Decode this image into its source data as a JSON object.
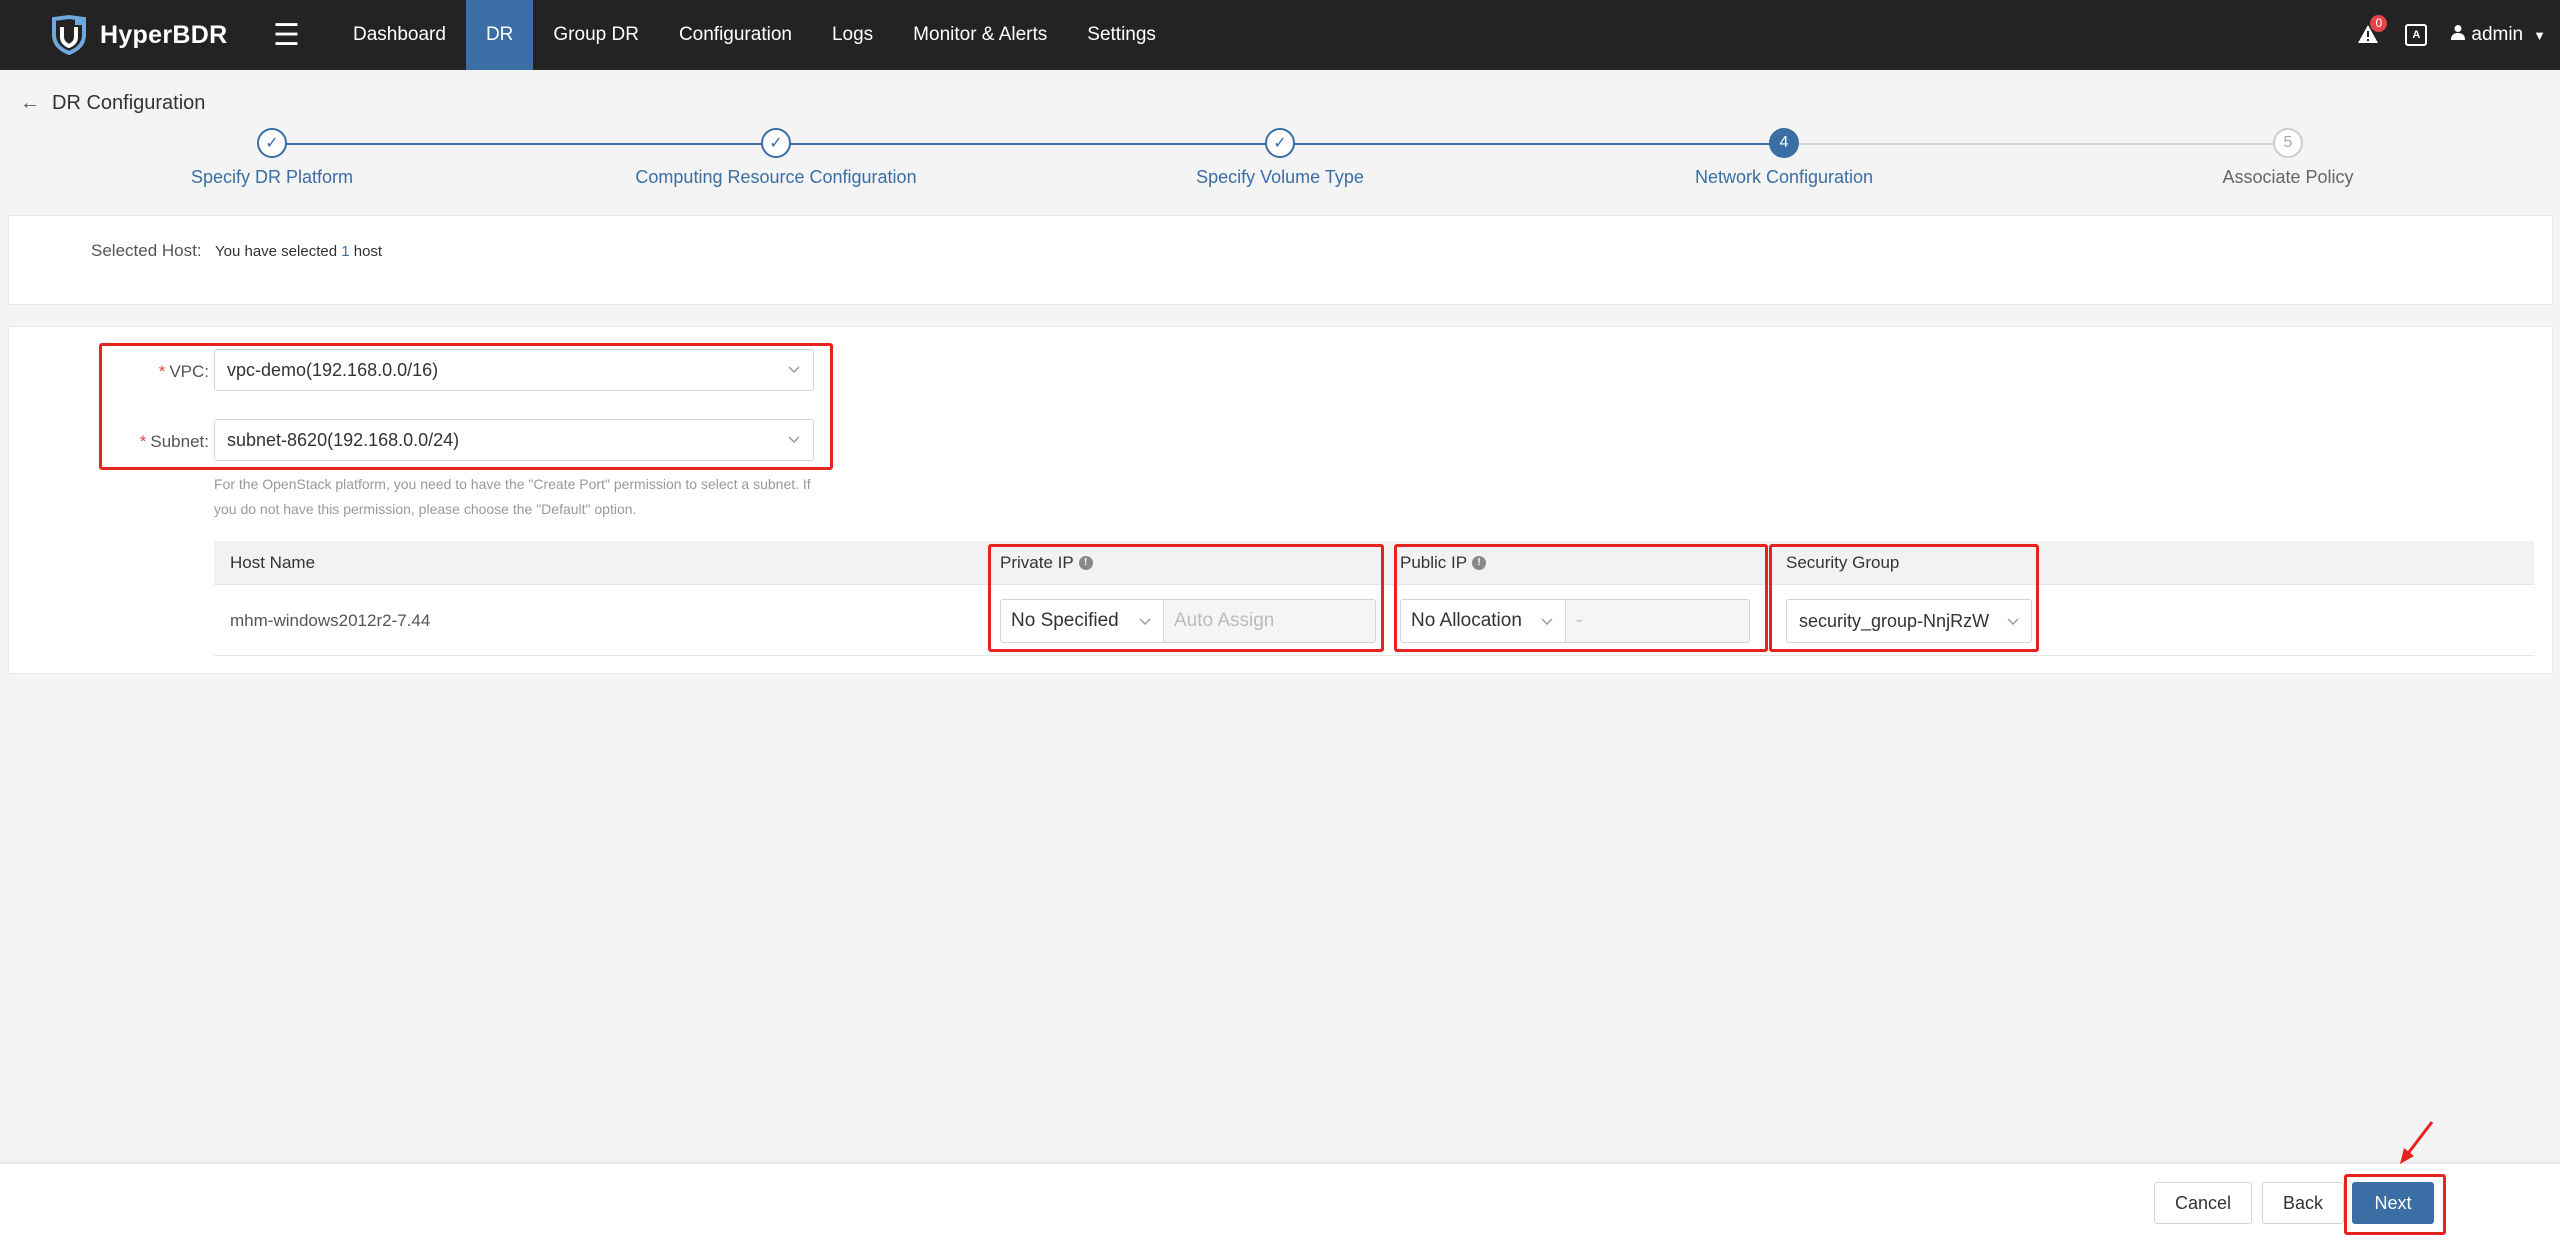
{
  "app": {
    "name": "HyperBDR",
    "colors": {
      "accent": "#3a6ea5",
      "topbar": "#232323",
      "highlight": "#e8231f",
      "badge": "#e54545"
    }
  },
  "nav": {
    "items": [
      {
        "label": "Dashboard"
      },
      {
        "label": "DR",
        "active": true
      },
      {
        "label": "Group DR"
      },
      {
        "label": "Configuration"
      },
      {
        "label": "Logs"
      },
      {
        "label": "Monitor & Alerts"
      },
      {
        "label": "Settings"
      }
    ]
  },
  "topright": {
    "notification_count": "0",
    "lang_icon": "language-icon",
    "user": "admin"
  },
  "page": {
    "title": "DR Configuration"
  },
  "stepper": {
    "steps": [
      {
        "label": "Specify DR Platform",
        "state": "done",
        "icon": "check-icon"
      },
      {
        "label": "Computing Resource Configuration",
        "state": "done",
        "icon": "check-icon"
      },
      {
        "label": "Specify Volume Type",
        "state": "done",
        "icon": "check-icon"
      },
      {
        "label": "Network Configuration",
        "state": "current",
        "number": "4"
      },
      {
        "label": "Associate Policy",
        "state": "pending",
        "number": "5"
      }
    ]
  },
  "selected_host": {
    "label": "Selected Host:",
    "prefix": "You have selected",
    "count": "1",
    "suffix": "host"
  },
  "form": {
    "vpc": {
      "label": "VPC:",
      "value": "vpc-demo(192.168.0.0/16)"
    },
    "subnet": {
      "label": "Subnet:",
      "value": "subnet-8620(192.168.0.0/24)"
    },
    "hint": "For the OpenStack platform, you need to have the \"Create Port\" permission to select a subnet. If you do not have this permission, please choose the \"Default\" option."
  },
  "table": {
    "headers": {
      "host_name": "Host Name",
      "private_ip": "Private IP",
      "public_ip": "Public IP",
      "security_group": "Security Group"
    },
    "rows": [
      {
        "host_name": "mhm-windows2012r2-7.44",
        "private_ip_mode": "No Specified",
        "private_ip_placeholder": "Auto Assign",
        "public_ip_mode": "No Allocation",
        "public_ip_value": "-",
        "security_group": "security_group-NnjRzW"
      }
    ]
  },
  "footer": {
    "cancel": "Cancel",
    "back": "Back",
    "next": "Next"
  }
}
